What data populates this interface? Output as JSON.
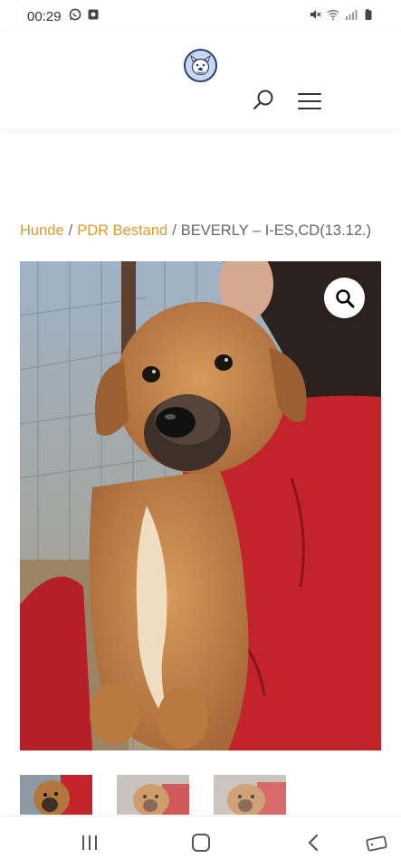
{
  "status_bar": {
    "time": "00:29",
    "left_icons": [
      "whatsapp-icon",
      "notification-icon"
    ],
    "right_icons": [
      "mute-icon",
      "wifi-icon",
      "signal-icon",
      "battery-icon"
    ]
  },
  "header": {
    "logo_icon": "dog-logo-icon",
    "search_icon": "search-icon",
    "menu_icon": "hamburger-menu-icon"
  },
  "breadcrumb": {
    "items": [
      {
        "label": "Hunde"
      },
      {
        "label": "PDR Bestand"
      }
    ],
    "separator": "/",
    "current": "BEVERLY – I-ES,CD(13.12.)"
  },
  "product": {
    "image_subject": "puppy held by person in red jacket",
    "zoom_icon": "magnifier-icon",
    "thumbnail_count": 3
  },
  "nav": {
    "items": [
      "recent-apps-icon",
      "home-icon",
      "back-icon",
      "rotate-icon"
    ]
  },
  "colors": {
    "link": "#e09b2d",
    "text": "#666666"
  }
}
